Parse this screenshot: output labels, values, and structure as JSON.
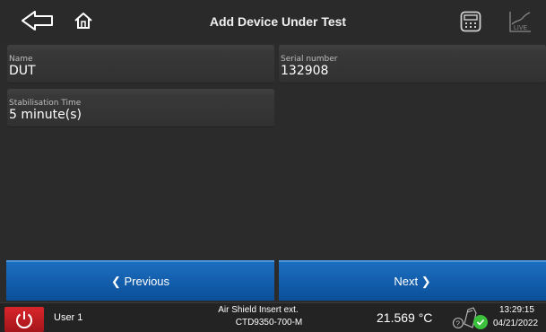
{
  "header": {
    "title": "Add Device Under Test",
    "icons": [
      "back-arrow-icon",
      "home-icon",
      "calculator-icon",
      "live-chart-icon"
    ],
    "live_label": "LIVE"
  },
  "fields": {
    "name": {
      "label": "Name",
      "value": "DUT"
    },
    "serial": {
      "label": "Serial number",
      "value": "132908"
    },
    "stabilisation": {
      "label": "Stabilisation Time",
      "value": "5 minute(s)"
    }
  },
  "nav": {
    "previous": "❮ Previous",
    "next": "Next ❯"
  },
  "status": {
    "user": "User 1",
    "sensor_line1": "Air Shield Insert ext.",
    "sensor_line2": "CTD9350-700-M",
    "temperature": "21.569 °C",
    "time": "13:29:15",
    "date": "04/21/2022",
    "colors": {
      "power": "#d9262b",
      "ok": "#3cc13c",
      "button": "#1565b3"
    }
  }
}
